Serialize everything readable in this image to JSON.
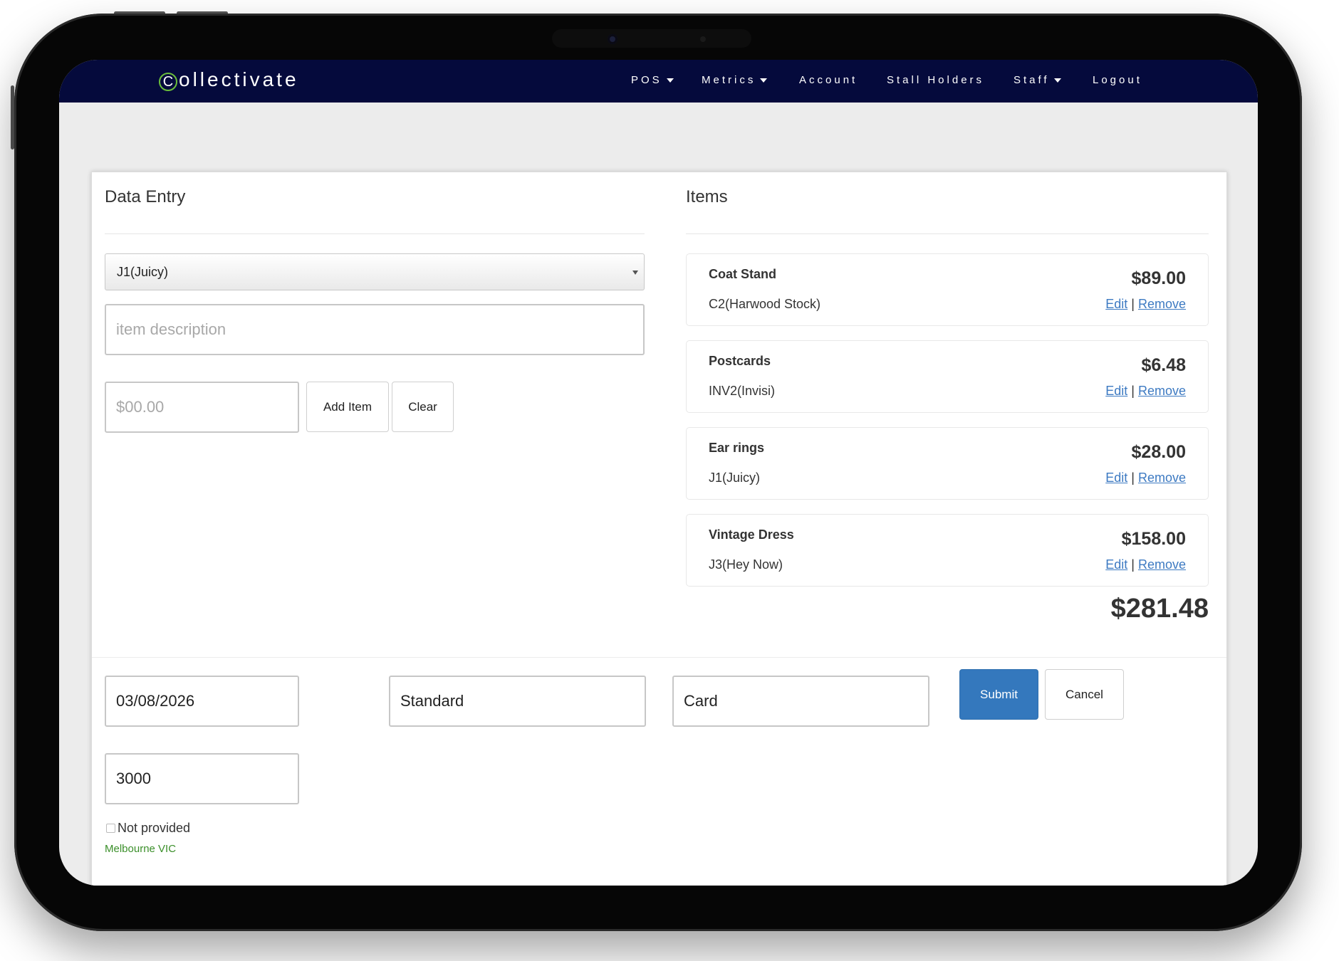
{
  "app": {
    "logo_initial": "C",
    "logo_rest": "ollectivate"
  },
  "nav": {
    "items": [
      {
        "label": "POS",
        "dropdown": true
      },
      {
        "label": "Metrics",
        "dropdown": true
      },
      {
        "label": "Account",
        "dropdown": false
      },
      {
        "label": "Stall Holders",
        "dropdown": false
      },
      {
        "label": "Staff",
        "dropdown": true
      },
      {
        "label": "Logout",
        "dropdown": false
      }
    ]
  },
  "data_entry": {
    "heading": "Data Entry",
    "stall_select_value": "J1(Juicy)",
    "description_placeholder": "item description",
    "price_placeholder": "$00.00",
    "add_item_label": "Add Item",
    "clear_label": "Clear"
  },
  "items_panel": {
    "heading": "Items",
    "edit_label": "Edit",
    "separator": "|",
    "remove_label": "Remove",
    "items": [
      {
        "name": "Coat Stand",
        "stall": "C2(Harwood Stock)",
        "price": "$89.00"
      },
      {
        "name": "Postcards",
        "stall": "INV2(Invisi)",
        "price": "$6.48"
      },
      {
        "name": "Ear rings",
        "stall": "J1(Juicy)",
        "price": "$28.00"
      },
      {
        "name": "Vintage Dress",
        "stall": "J3(Hey Now)",
        "price": "$158.00"
      }
    ],
    "total": "$281.48"
  },
  "footer_form": {
    "date_value": "03/08/2026",
    "sale_type_value": "Standard",
    "payment_value": "Card",
    "submit_label": "Submit",
    "cancel_label": "Cancel",
    "postcode_value": "3000",
    "not_provided_label": "Not provided",
    "location_text": "Melbourne VIC"
  },
  "colors": {
    "navbar": "#050a3c",
    "primary_button": "#3478bd",
    "link": "#3d7ac2",
    "location_text": "#3b8f2a",
    "logo_accent": "#6bbf3b"
  }
}
